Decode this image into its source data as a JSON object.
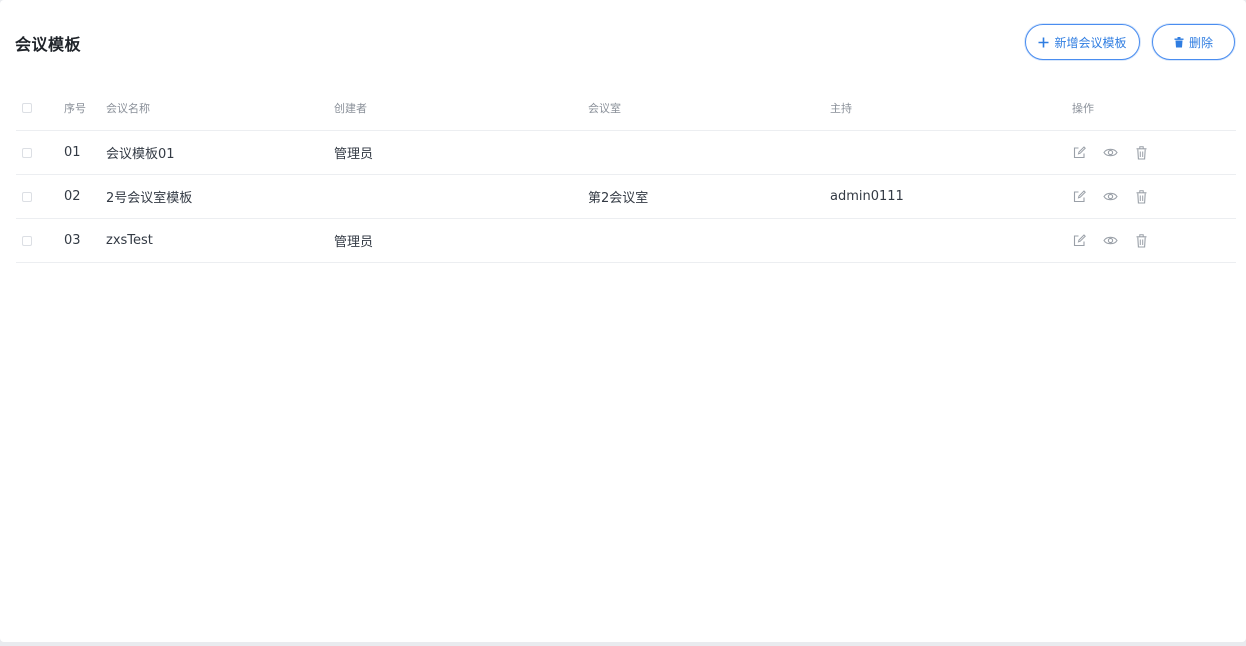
{
  "page": {
    "title": "会议模板"
  },
  "toolbar": {
    "add_label": "新增会议模板",
    "add_icon": "plus-icon",
    "delete_label": "删除",
    "delete_icon": "trash-icon"
  },
  "colors": {
    "accent": "#2f7de1",
    "text": "#333a44",
    "header_text": "#8a9099",
    "icon": "#9aa0a8",
    "border": "#eceef1"
  },
  "table": {
    "columns": [
      "序号",
      "会议名称",
      "创建者",
      "会议室",
      "主持",
      "操作"
    ],
    "row_actions": [
      "edit-icon",
      "view-icon",
      "delete-icon"
    ],
    "rows": [
      {
        "no": "01",
        "name": "会议模板01",
        "creator": "管理员",
        "room": "",
        "host": ""
      },
      {
        "no": "02",
        "name": "2号会议室模板",
        "creator": "",
        "room": "第2会议室",
        "host": "admin0111"
      },
      {
        "no": "03",
        "name": "zxsTest",
        "creator": "管理员",
        "room": "",
        "host": ""
      }
    ]
  }
}
